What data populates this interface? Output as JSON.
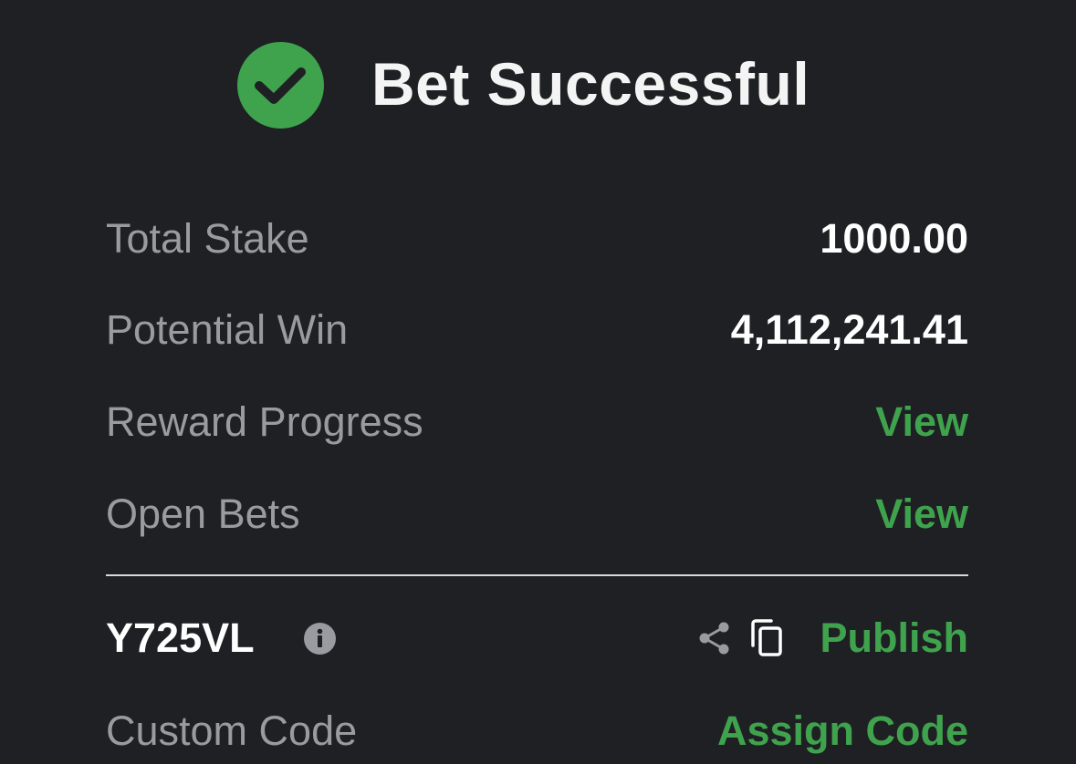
{
  "header": {
    "title": "Bet Successful"
  },
  "summary": {
    "total_stake_label": "Total Stake",
    "total_stake_value": "1000.00",
    "potential_win_label": "Potential Win",
    "potential_win_value": "4,112,241.41",
    "reward_progress_label": "Reward Progress",
    "reward_progress_link": "View",
    "open_bets_label": "Open Bets",
    "open_bets_link": "View"
  },
  "booking": {
    "code": "Y725VL",
    "publish_label": "Publish",
    "custom_code_label": "Custom Code",
    "assign_code_label": "Assign Code"
  },
  "icons": {
    "success": "check-circle-icon",
    "info": "info-icon",
    "share": "share-icon",
    "copy": "copy-icon"
  },
  "colors": {
    "background": "#1f2024",
    "accent_green": "#3fa34d",
    "label_gray": "#9a9ba1",
    "value_white": "#ffffff"
  }
}
